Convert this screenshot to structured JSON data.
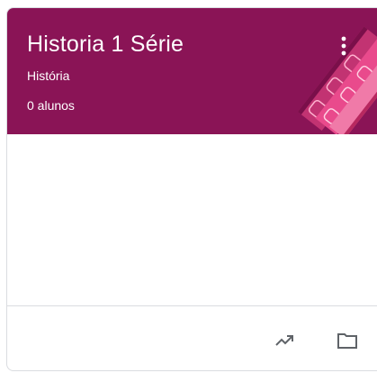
{
  "card": {
    "title": "Historia 1 Série",
    "subtitle": "História",
    "students": "0 alunos",
    "theme_color": "#8a1456",
    "accent_color": "#e94a8c"
  },
  "actions": {
    "more_icon": "more-vert-icon",
    "trend_icon": "trending-up-icon",
    "folder_icon": "folder-icon"
  }
}
